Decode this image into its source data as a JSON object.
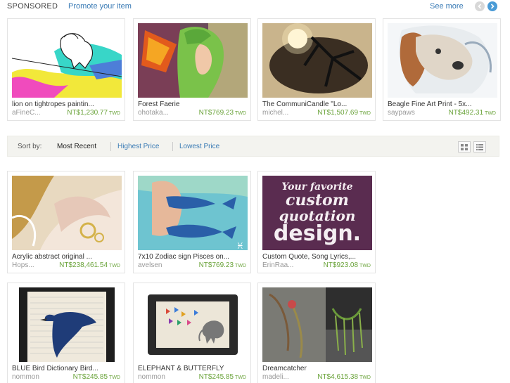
{
  "sponsored": {
    "label": "SPONSORED",
    "promote_link": "Promote your item",
    "see_more": "See more",
    "items": [
      {
        "title": "lion on tightropes paintin...",
        "shop": "aFineC...",
        "price": "NT$1,230.77",
        "currency": "TWD",
        "image": "lion-tightrope-painting"
      },
      {
        "title": "Forest Faerie",
        "shop": "ohotaka...",
        "price": "NT$769.23",
        "currency": "TWD",
        "image": "forest-faerie-painting"
      },
      {
        "title": "The CommuniCandle \"Lo...",
        "shop": "michel...",
        "price": "NT$1,507.69",
        "currency": "TWD",
        "image": "candle-holder"
      },
      {
        "title": "Beagle Fine Art Print - 5x...",
        "shop": "saypaws",
        "price": "NT$492.31",
        "currency": "TWD",
        "image": "beagle-print"
      }
    ]
  },
  "sort": {
    "label": "Sort by:",
    "options": [
      "Most Recent",
      "Highest Price",
      "Lowest Price"
    ],
    "active": "Most Recent"
  },
  "listings": [
    {
      "title": "Acrylic abstract original ...",
      "shop": "Hops...",
      "price": "NT$238,461.54",
      "currency": "TWD",
      "image": "acrylic-abstract"
    },
    {
      "title": "7x10 Zodiac sign Pisces on...",
      "shop": "avelsen",
      "price": "NT$769.23",
      "currency": "TWD",
      "image": "pisces-painting"
    },
    {
      "title": "Custom Quote, Song Lyrics,...",
      "shop": "ErinRaa...",
      "price": "NT$923.08",
      "currency": "TWD",
      "image": "custom-quote-print"
    },
    {
      "title": "BLUE Bird Dictionary Bird...",
      "shop": "nommon",
      "price": "NT$245.85",
      "currency": "TWD",
      "image": "bluebird-dictionary-print"
    },
    {
      "title": "ELEPHANT & BUTTERFLY",
      "shop": "nommon",
      "price": "NT$245.85",
      "currency": "TWD",
      "image": "elephant-butterfly-print"
    },
    {
      "title": "Dreamcatcher",
      "shop": "madeli...",
      "price": "NT$4,615.38",
      "currency": "TWD",
      "image": "dreamcatcher"
    }
  ],
  "quote_art": {
    "lines": [
      "Your favorite",
      "custom",
      "quotation",
      "design."
    ]
  }
}
